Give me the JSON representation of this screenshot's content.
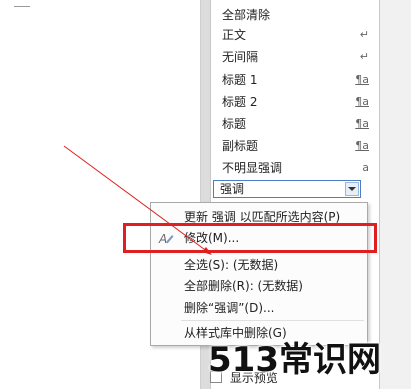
{
  "styles_pane": {
    "items": [
      {
        "label": "全部清除",
        "mark": ""
      },
      {
        "label": "正文",
        "mark": "↵"
      },
      {
        "label": "无间隔",
        "mark": "↵"
      },
      {
        "label": "标题 1",
        "mark": "¶a"
      },
      {
        "label": "标题 2",
        "mark": "¶a"
      },
      {
        "label": "标题",
        "mark": "¶a"
      },
      {
        "label": "副标题",
        "mark": "¶a"
      },
      {
        "label": "不明显强调",
        "mark": "a"
      }
    ],
    "selected": {
      "label": "强调"
    }
  },
  "context_menu": {
    "items": [
      {
        "label": "更新 强调 以匹配所选内容(P)"
      },
      {
        "label": "修改(M)..."
      },
      {
        "label": "全选(S): (无数据)"
      },
      {
        "label": "全部删除(R): (无数据)"
      },
      {
        "label": "删除“强调”(D)..."
      },
      {
        "label": "从样式库中删除(G)"
      }
    ]
  },
  "footer": {
    "show_preview_label": "显示预览"
  },
  "watermark": {
    "text": "513常识网"
  },
  "colors": {
    "highlight": "#e02020",
    "selection_border": "#4a7fc4"
  }
}
